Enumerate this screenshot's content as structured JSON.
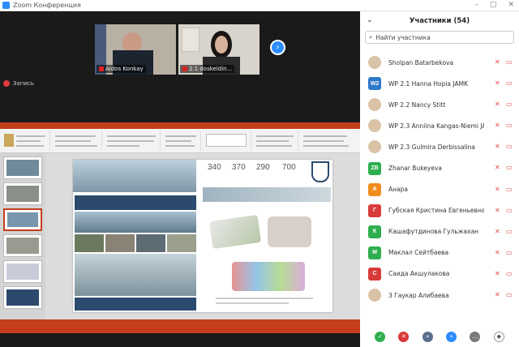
{
  "window": {
    "title": "Zoom Конференция"
  },
  "videos": [
    {
      "name": "Aidos Konkay"
    },
    {
      "name": "2.1 doskeldin..."
    }
  ],
  "recording": {
    "label": "Запись"
  },
  "slide": {
    "stats": [
      "340",
      "370",
      "290",
      "700"
    ]
  },
  "panel": {
    "title": "Участники (54)",
    "search_placeholder": "Найти участника",
    "participants": [
      {
        "name": "Sholpan Batarbekova",
        "initials": "",
        "color": ""
      },
      {
        "name": "WP 2.1 Hanna Hopia JAMK",
        "initials": "W2",
        "color": "#2e78c8"
      },
      {
        "name": "WP 2.2 Nancy Stitt",
        "initials": "",
        "color": ""
      },
      {
        "name": "WP 2.3 Anniina Kangas-Niemi JA...",
        "initials": "",
        "color": ""
      },
      {
        "name": "WP 2.3 Gulmira Derbissalina",
        "initials": "",
        "color": ""
      },
      {
        "name": "Zhanar Bukeyeva",
        "initials": "ZB",
        "color": "#2fae4f"
      },
      {
        "name": "Анара",
        "initials": "А",
        "color": "#f08c1e"
      },
      {
        "name": "Губская Кристина Евгеньевна",
        "initials": "Г",
        "color": "#d93a3a"
      },
      {
        "name": "Кашафутдинова Гульжахан",
        "initials": "К",
        "color": "#2fae4f"
      },
      {
        "name": "Маклал Сейтбаева",
        "initials": "М",
        "color": "#2fae4f"
      },
      {
        "name": "Саида Акшулакова",
        "initials": "С",
        "color": "#d93a3a"
      },
      {
        "name": "3 Гаукар Алибаева",
        "initials": "",
        "color": ""
      }
    ]
  },
  "colors": {
    "accent": "#2d8cff",
    "ppt": "#c43e1c",
    "mic_muted": "#e24a4a"
  }
}
